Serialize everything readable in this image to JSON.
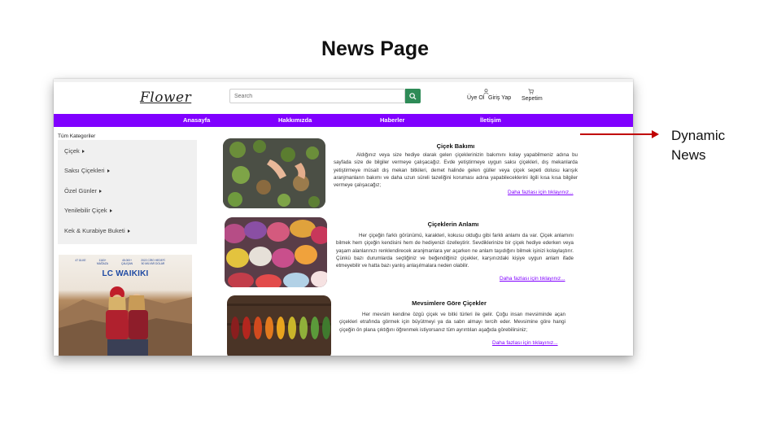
{
  "slide": {
    "title": "News Page"
  },
  "annotation": {
    "line1": "Dynamic",
    "line2": "News"
  },
  "header": {
    "logo": "Flower",
    "search_placeholder": "Search",
    "register": "Üye Ol",
    "login": "Giriş Yap",
    "cart": "Sepetim"
  },
  "nav": {
    "items": [
      "Anasayfa",
      "Hakkımızda",
      "Haberler",
      "İletişim"
    ],
    "bg_color": "#8000ff"
  },
  "sidebar": {
    "title": "Tüm Kategoriler",
    "categories": [
      "Çiçek",
      "Saksı Çiçekleri",
      "Özel Günler",
      "Yenilebilir Çiçek",
      "Kek & Kurabiye Buketi"
    ]
  },
  "ad": {
    "brand": "LC WAIKIKI",
    "stats": [
      "47 ÜLKE",
      "1163+ MAĞAZA",
      "45.000+ ÇALIŞAN",
      "2022 CİRO HEDEFİ 50 MİLYAR DOLAR"
    ]
  },
  "news": [
    {
      "title": "Çiçek Bakımı",
      "body": "Aldığınız veya size hediye olarak gelen çiçeklerinizin bakımını kolay yapabilmeniz adına bu sayfada size de bilgiler vermeye çalışacağız. Evde yetiştirmeye uygun saksı çiçekleri, dış mekanlarda yetiştirmeye müsait dış mekan bitkileri, demet halinde gelen güller veya çiçek sepeti dolusu karışık aranjmanların bakımı ve daha uzun süreli tazeliğini koruması adına yapabileceklerini ilgili kısa kısa bilgiler vermeye çalışacağız;",
      "more": "Daha fazlası için tıklayınız..."
    },
    {
      "title": "Çiçeklerin Anlamı",
      "body": "Her çiçeğin farklı görünümü, karakteri, kokusu olduğu gibi farklı anlamı da var. Çiçek anlamını bilmek hem çiçeğin kendisini hem de hediyenizi özelleştirir. Sevdiklerinize bir çiçek hediye ederken veya yaşam alanlarınızı renklendirecek aranjmanlara yer açarken ne anlam taşıdığını bilmek işinizi kolaylaştırır. Çünkü bazı durumlarda seçtiğiniz ve beğendiğiniz çiçekler, karşınızdaki kişiye uygun anlam ifade etmeyebilir ve hatta bazı yanlış anlaşılmalara neden olabilir.",
      "more": "Daha fazlası için tıklayınız..."
    },
    {
      "title": "Mevsimlere Göre Çiçekler",
      "body": "Her mevsim kendine özgü çiçek ve bitki türleri ile gelir. Çoğu insan mevsiminde açan çiçekleri etrafında görmek için büyütmeyi ya da sabrı almayı tercih eder. Mevsimine göre hangi çiçeğin ön plana çıktığını öğrenmek istiyorsanız tüm ayrıntıları aşağıda görebilirsiniz;",
      "more": "Daha fazlası için tıklayınız..."
    }
  ]
}
